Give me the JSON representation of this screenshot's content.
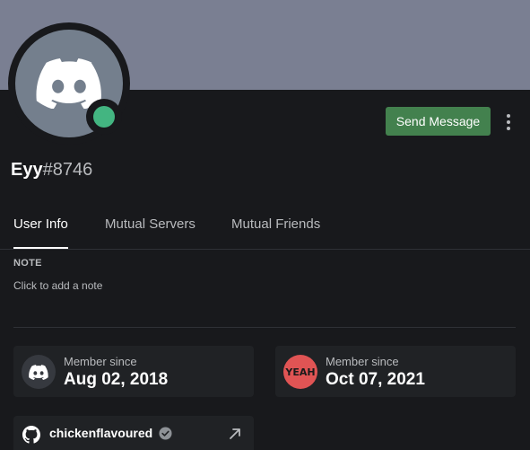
{
  "profile": {
    "username": "Eyy",
    "discriminator": "#8746",
    "status": "online",
    "status_color": "#43b581",
    "banner_color": "#7a7f92",
    "avatar_color": "#747f8d",
    "avatar_icon": "discord-logo-icon"
  },
  "actions": {
    "send_message_label": "Send Message",
    "send_message_color": "#43814e",
    "more_icon": "more-vertical-icon"
  },
  "tabs": [
    {
      "label": "User Info",
      "active": true
    },
    {
      "label": "Mutual Servers",
      "active": false
    },
    {
      "label": "Mutual Friends",
      "active": false
    }
  ],
  "note": {
    "heading": "NOTE",
    "placeholder": "Click to add a note"
  },
  "member_since": [
    {
      "icon": "discord-logo-icon",
      "label": "Member since",
      "date": "Aug 02, 2018"
    },
    {
      "icon": "server-yeah-icon",
      "icon_text": "YEAH",
      "icon_color": "#e05454",
      "label": "Member since",
      "date": "Oct 07, 2021"
    }
  ],
  "connections": [
    {
      "service_icon": "github-icon",
      "name": "chickenflavoured",
      "verified": true,
      "link_icon": "external-link-icon"
    }
  ]
}
